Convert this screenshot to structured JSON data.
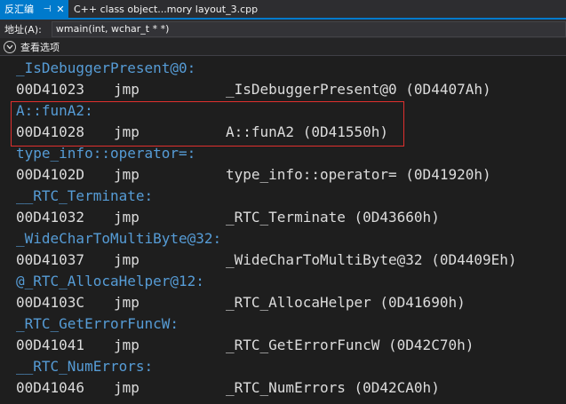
{
  "tabs": {
    "active": {
      "label": "反汇编",
      "pin_glyph": "⊣",
      "close_glyph": "✕"
    },
    "inactive": {
      "label": "C++ class object...mory layout_3.cpp"
    }
  },
  "address": {
    "label": "地址(A):",
    "value": "wmain(int, wchar_t * *)"
  },
  "view_options": {
    "label": "查看选项"
  },
  "colors": {
    "accent": "#007acc",
    "label": "#569cd6",
    "text": "#dcdcdc",
    "highlight": "#e0302e"
  },
  "disasm": [
    {
      "type": "label",
      "text": "_IsDebuggerPresent@0:"
    },
    {
      "type": "instr",
      "addr": "00D41023",
      "mnem": "jmp",
      "operand": "_IsDebuggerPresent@0 (0D4407Ah)"
    },
    {
      "type": "label",
      "text": "A::funA2:"
    },
    {
      "type": "instr",
      "addr": "00D41028",
      "mnem": "jmp",
      "operand": "A::funA2 (0D41550h)"
    },
    {
      "type": "label",
      "text": "type_info::operator=:"
    },
    {
      "type": "instr",
      "addr": "00D4102D",
      "mnem": "jmp",
      "operand": "type_info::operator= (0D41920h)"
    },
    {
      "type": "label",
      "text": "__RTC_Terminate:"
    },
    {
      "type": "instr",
      "addr": "00D41032",
      "mnem": "jmp",
      "operand": "_RTC_Terminate (0D43660h)"
    },
    {
      "type": "label",
      "text": "_WideCharToMultiByte@32:"
    },
    {
      "type": "instr",
      "addr": "00D41037",
      "mnem": "jmp",
      "operand": "_WideCharToMultiByte@32 (0D4409Eh)"
    },
    {
      "type": "label",
      "text": "@_RTC_AllocaHelper@12:"
    },
    {
      "type": "instr",
      "addr": "00D4103C",
      "mnem": "jmp",
      "operand": "_RTC_AllocaHelper (0D41690h)"
    },
    {
      "type": "label",
      "text": "_RTC_GetErrorFuncW:"
    },
    {
      "type": "instr",
      "addr": "00D41041",
      "mnem": "jmp",
      "operand": "_RTC_GetErrorFuncW (0D42C70h)"
    },
    {
      "type": "label",
      "text": "__RTC_NumErrors:"
    },
    {
      "type": "instr",
      "addr": "00D41046",
      "mnem": "jmp",
      "operand": "_RTC_NumErrors (0D42CA0h)"
    }
  ]
}
